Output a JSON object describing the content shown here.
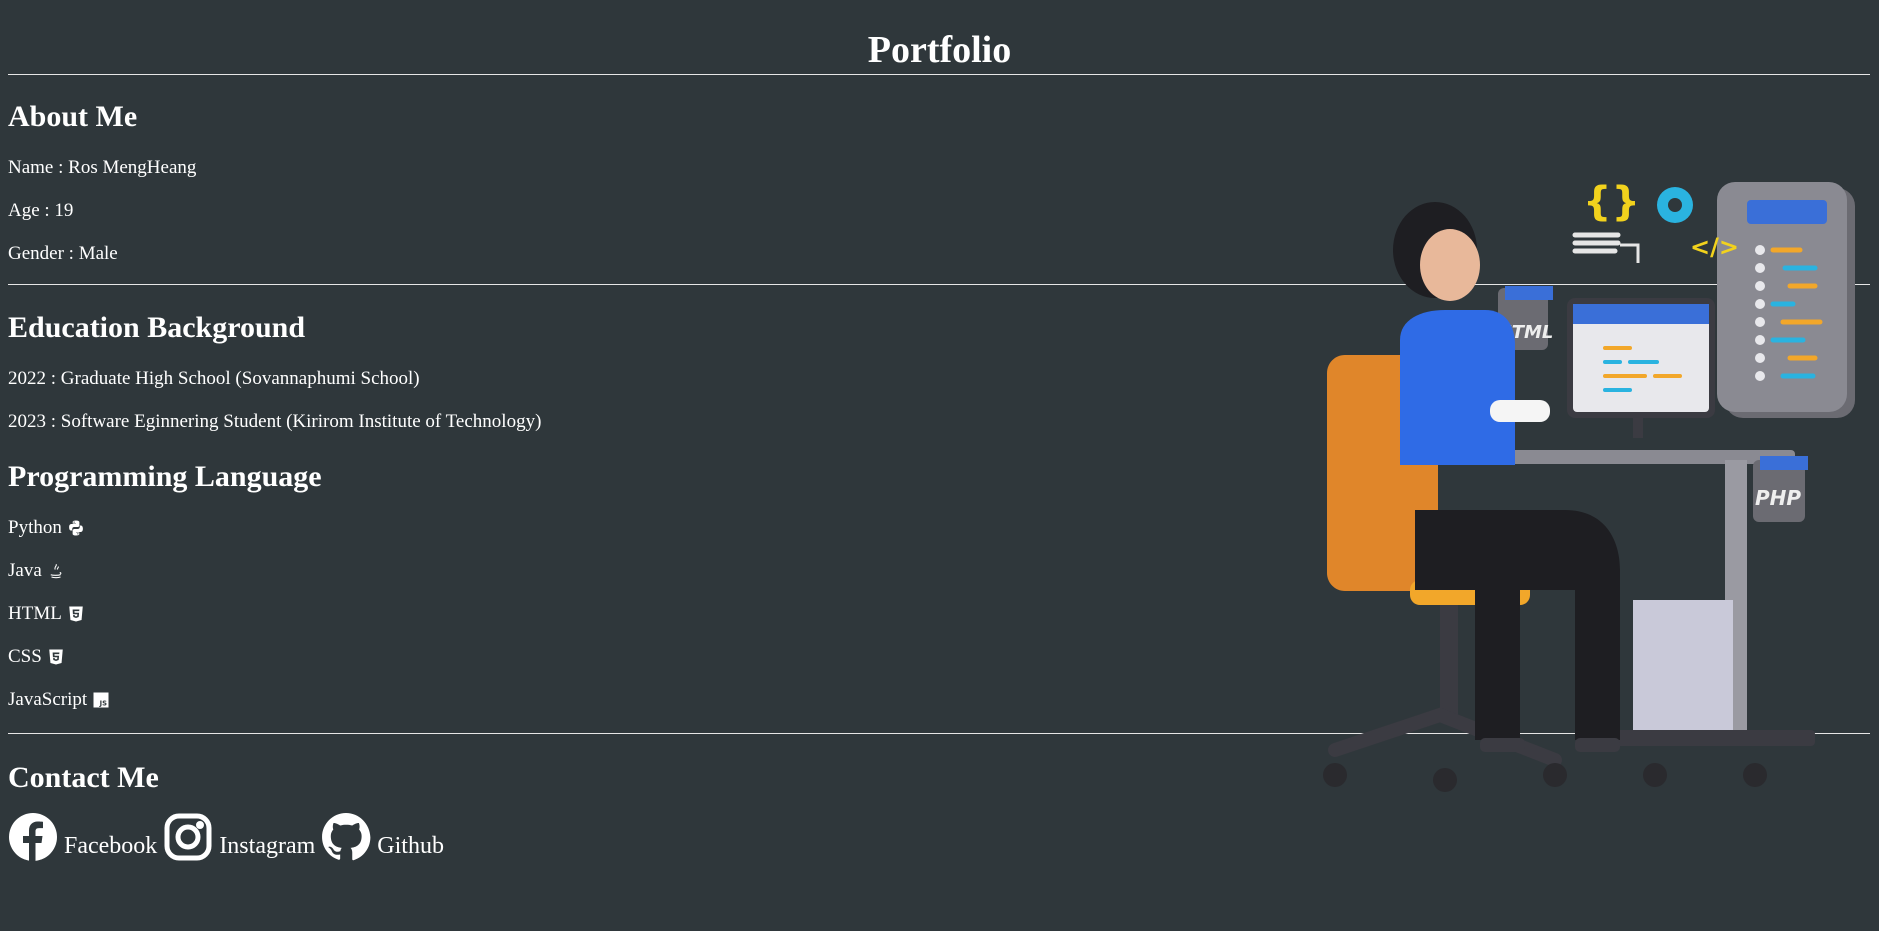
{
  "page": {
    "title": "Portfolio"
  },
  "about": {
    "heading": "About Me",
    "lines": [
      "Name : Ros MengHeang",
      "Age : 19",
      "Gender : Male"
    ]
  },
  "education": {
    "heading": "Education Background",
    "lines": [
      "2022 : Graduate High School (Sovannaphumi School)",
      "2023 : Software Eginnering Student (Kirirom Institute of Technology)"
    ]
  },
  "languages": {
    "heading": "Programming Language",
    "items": [
      {
        "label": "Python",
        "icon": "python-icon"
      },
      {
        "label": "Java",
        "icon": "java-icon"
      },
      {
        "label": "HTML",
        "icon": "html5-icon"
      },
      {
        "label": "CSS",
        "icon": "css3-icon"
      },
      {
        "label": "JavaScript",
        "icon": "javascript-icon"
      }
    ]
  },
  "contact": {
    "heading": "Contact Me",
    "links": [
      {
        "label": "Facebook",
        "icon": "facebook-icon"
      },
      {
        "label": "Instagram",
        "icon": "instagram-icon"
      },
      {
        "label": "Github",
        "icon": "github-icon"
      }
    ]
  },
  "illustration": {
    "html_badge": "HTML",
    "php_badge": "PHP",
    "braces_glyph": "{}",
    "code_glyph": "</>"
  },
  "colors": {
    "background": "#2f373b",
    "text": "#ffffff"
  }
}
